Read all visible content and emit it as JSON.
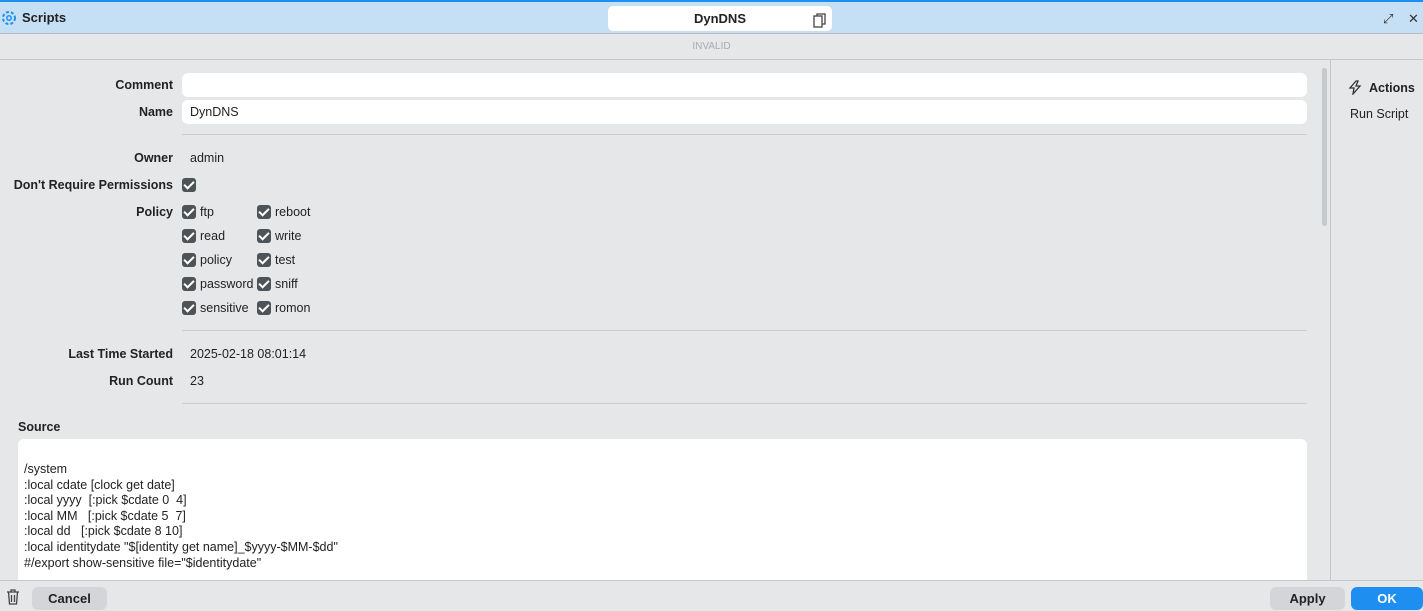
{
  "window": {
    "title": "Scripts",
    "tab_name": "DynDNS",
    "status": "INVALID"
  },
  "form": {
    "comment_label": "Comment",
    "comment_value": "",
    "name_label": "Name",
    "name_value": "DynDNS",
    "owner_label": "Owner",
    "owner_value": "admin",
    "dont_require_label": "Don't Require Permissions",
    "policy_label": "Policy",
    "policies": [
      {
        "label": "ftp",
        "checked": true
      },
      {
        "label": "reboot",
        "checked": true
      },
      {
        "label": "read",
        "checked": true
      },
      {
        "label": "write",
        "checked": true
      },
      {
        "label": "policy",
        "checked": true
      },
      {
        "label": "test",
        "checked": true
      },
      {
        "label": "password",
        "checked": true
      },
      {
        "label": "sniff",
        "checked": true
      },
      {
        "label": "sensitive",
        "checked": true
      },
      {
        "label": "romon",
        "checked": true
      }
    ],
    "last_started_label": "Last Time Started",
    "last_started_value": "2025-02-18 08:01:14",
    "run_count_label": "Run Count",
    "run_count_value": "23",
    "source_label": "Source",
    "source_value": "/system\n:local cdate [clock get date]\n:local yyyy  [:pick $cdate 0  4]\n:local MM   [:pick $cdate 5  7]\n:local dd   [:pick $cdate 8 10]\n:local identitydate \"$[identity get name]_$yyyy-$MM-$dd\"\n#/export show-sensitive file=\"$identitydate\""
  },
  "actions": {
    "title": "Actions",
    "run_script": "Run Script"
  },
  "footer": {
    "cancel": "Cancel",
    "apply": "Apply",
    "ok": "OK"
  },
  "colors": {
    "accent": "#1e8ff0",
    "titlebar": "#c5e0f5"
  }
}
